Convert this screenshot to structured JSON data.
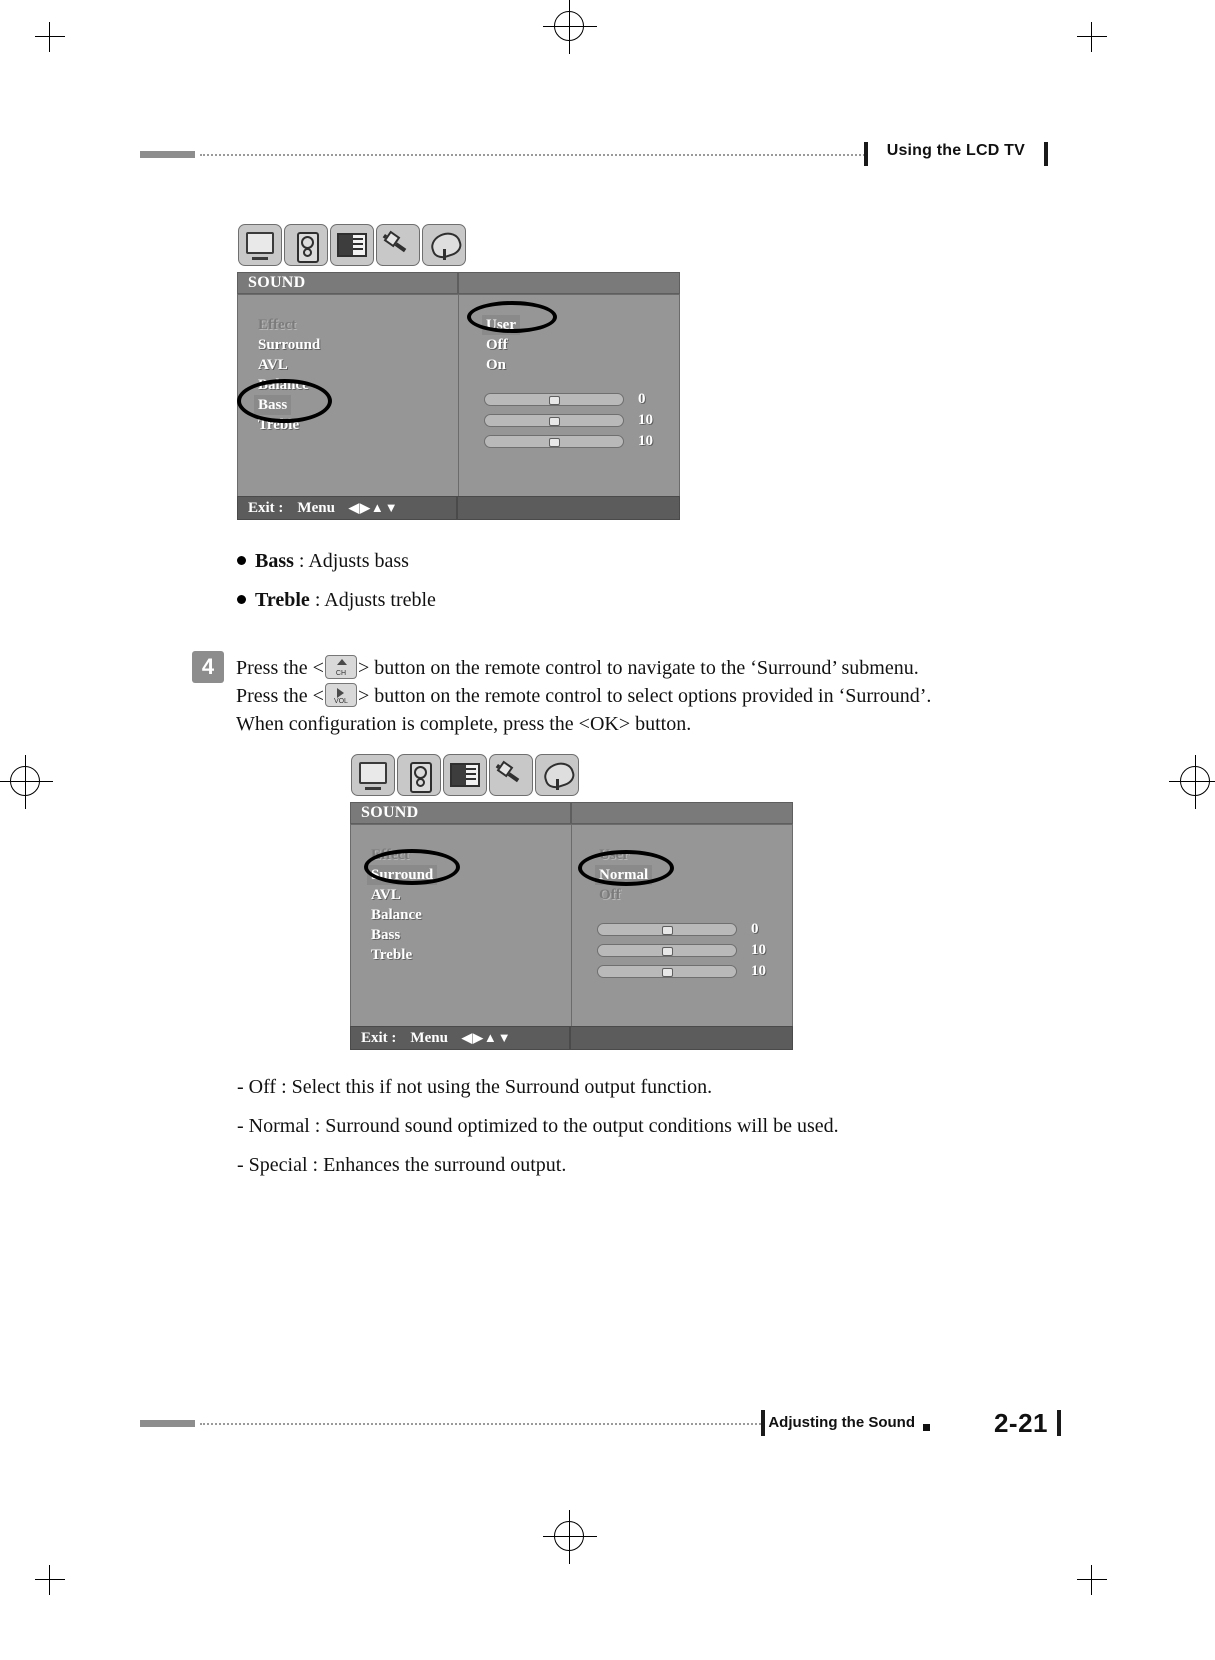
{
  "header": {
    "title": "Using the LCD TV"
  },
  "footer": {
    "section": "Adjusting the Sound",
    "page": "2-21"
  },
  "osd1": {
    "title": "SOUND",
    "left_items": [
      {
        "label": "Effect",
        "state": "dim"
      },
      {
        "label": "Surround",
        "state": "white"
      },
      {
        "label": "AVL",
        "state": "white"
      },
      {
        "label": "Balance",
        "state": "white"
      },
      {
        "label": "Bass",
        "state": "selected"
      },
      {
        "label": "Treble",
        "state": "white"
      }
    ],
    "right_items": [
      {
        "label": "User",
        "state": "selected"
      },
      {
        "label": "Off",
        "state": "white"
      },
      {
        "label": "On",
        "state": "white"
      }
    ],
    "sliders": [
      {
        "value": "0",
        "pos": 50
      },
      {
        "value": "10",
        "pos": 50
      },
      {
        "value": "10",
        "pos": 50
      }
    ],
    "footer": {
      "exit": "Exit :",
      "menu": "Menu",
      "arrows": "◀▶▲▼"
    },
    "icons": [
      "tv-icon",
      "speaker-icon",
      "picture-icon",
      "tool-icon",
      "satellite-dish-icon"
    ]
  },
  "osd2": {
    "title": "SOUND",
    "left_items": [
      {
        "label": "Effect",
        "state": "dim"
      },
      {
        "label": "Surround",
        "state": "selected"
      },
      {
        "label": "AVL",
        "state": "white"
      },
      {
        "label": "Balance",
        "state": "white"
      },
      {
        "label": "Bass",
        "state": "white"
      },
      {
        "label": "Treble",
        "state": "white"
      }
    ],
    "right_items": [
      {
        "label": "User",
        "state": "dim"
      },
      {
        "label": "Normal",
        "state": "selected"
      },
      {
        "label": "Off",
        "state": "white"
      }
    ],
    "sliders": [
      {
        "value": "0",
        "pos": 50
      },
      {
        "value": "10",
        "pos": 50
      },
      {
        "value": "10",
        "pos": 50
      }
    ],
    "footer": {
      "exit": "Exit :",
      "menu": "Menu",
      "arrows": "◀▶▲▼"
    },
    "icons": [
      "tv-icon",
      "speaker-icon",
      "picture-icon",
      "tool-icon",
      "satellite-dish-icon"
    ]
  },
  "bullets": [
    {
      "term": "Bass",
      "rest": " : Adjusts bass"
    },
    {
      "term": "Treble",
      "rest": " : Adjusts treble"
    }
  ],
  "step": {
    "number": "4",
    "line1_a": "Press the <",
    "line1_btn": "CH",
    "line1_b": "> button on the remote control to navigate to the ‘Surround’ submenu.",
    "line2_a": "Press the <",
    "line2_btn": "VOL",
    "line2_b": "> button on the remote control to select options provided in ‘Surround’.",
    "line3": "When configuration is complete, press the <OK> button."
  },
  "descriptions": [
    "- Off : Select this if not using the Surround output function.",
    "- Normal : Surround sound optimized to the output conditions will be used.",
    "- Special : Enhances the surround output."
  ]
}
